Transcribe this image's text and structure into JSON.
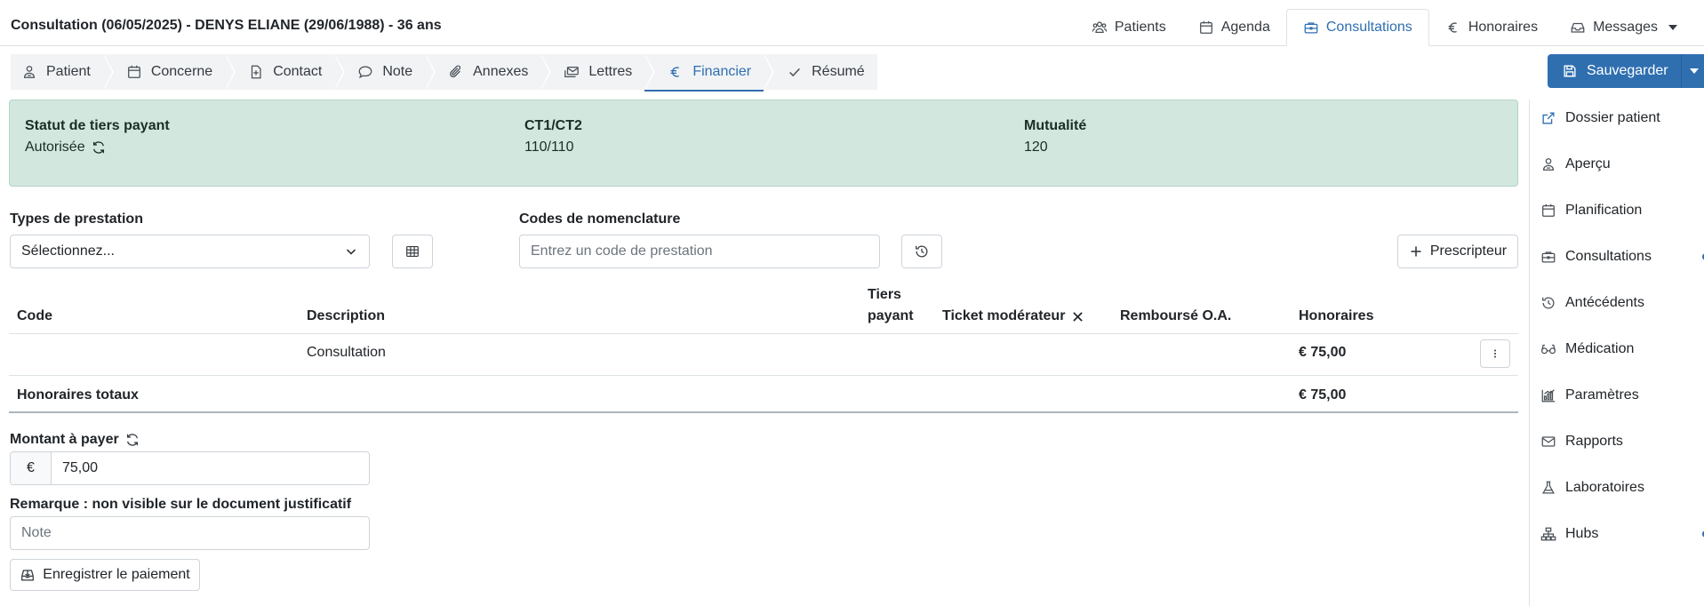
{
  "header": {
    "title": "Consultation (06/05/2025) - DENYS ELIANE (29/06/1988) - 36 ans",
    "nav": [
      {
        "label": "Patients",
        "icon": "users-icon"
      },
      {
        "label": "Agenda",
        "icon": "calendar-icon"
      },
      {
        "label": "Consultations",
        "icon": "briefcase-icon",
        "active": true
      },
      {
        "label": "Honoraires",
        "icon": "euro-icon"
      },
      {
        "label": "Messages",
        "icon": "inbox-icon"
      }
    ]
  },
  "steps": [
    {
      "label": "Patient",
      "icon": "person-icon"
    },
    {
      "label": "Concerne",
      "icon": "calendar-icon"
    },
    {
      "label": "Contact",
      "icon": "file-medical-icon"
    },
    {
      "label": "Note",
      "icon": "chat-icon"
    },
    {
      "label": "Annexes",
      "icon": "paperclip-icon"
    },
    {
      "label": "Lettres",
      "icon": "envelope-icon"
    },
    {
      "label": "Financier",
      "icon": "euro-icon",
      "active": true
    },
    {
      "label": "Résumé",
      "icon": "check-icon"
    }
  ],
  "save": {
    "label": "Sauvegarder"
  },
  "info": {
    "status_label": "Statut de tiers payant",
    "status_value": "Autorisée",
    "ct_label": "CT1/CT2",
    "ct_value": "110/110",
    "mut_label": "Mutualité",
    "mut_value": "120"
  },
  "side_menu": [
    {
      "label": "Dossier patient",
      "icon": "external-link-icon"
    },
    {
      "label": "Aperçu",
      "icon": "person-icon"
    },
    {
      "label": "Planification",
      "icon": "calendar-icon"
    },
    {
      "label": "Consultations",
      "icon": "briefcase-icon",
      "dot": true
    },
    {
      "label": "Antécédents",
      "icon": "history-icon"
    },
    {
      "label": "Médication",
      "icon": "glasses-icon"
    },
    {
      "label": "Paramètres",
      "icon": "bar-chart-icon"
    },
    {
      "label": "Rapports",
      "icon": "envelope-icon"
    },
    {
      "label": "Laboratoires",
      "icon": "flask-icon"
    },
    {
      "label": "Hubs",
      "icon": "diagram-icon",
      "dot": true
    }
  ],
  "form": {
    "types_label": "Types de prestation",
    "types_value": "Sélectionnez...",
    "codes_label": "Codes de nomenclature",
    "codes_placeholder": "Entrez un code de prestation",
    "prescripteur_label": "Prescripteur"
  },
  "table": {
    "headers": {
      "code": "Code",
      "description": "Description",
      "tiers_line1": "Tiers",
      "tiers_line2": "payant",
      "ticket": "Ticket modérateur",
      "rembourse": "Remboursé O.A.",
      "honoraires": "Honoraires"
    },
    "rows": [
      {
        "code": "",
        "description": "Consultation",
        "honoraires": "€ 75,00"
      }
    ],
    "total_label": "Honoraires totaux",
    "total_value": "€ 75,00"
  },
  "payment": {
    "amount_label": "Montant à payer",
    "currency": "€",
    "amount_value": "75,00",
    "remark_label": "Remarque : non visible sur le document justificatif",
    "note_placeholder": "Note",
    "pay_button": "Enregistrer le paiement"
  },
  "colors": {
    "accent": "#2f6fb0",
    "info_bg": "#d2e7de"
  }
}
